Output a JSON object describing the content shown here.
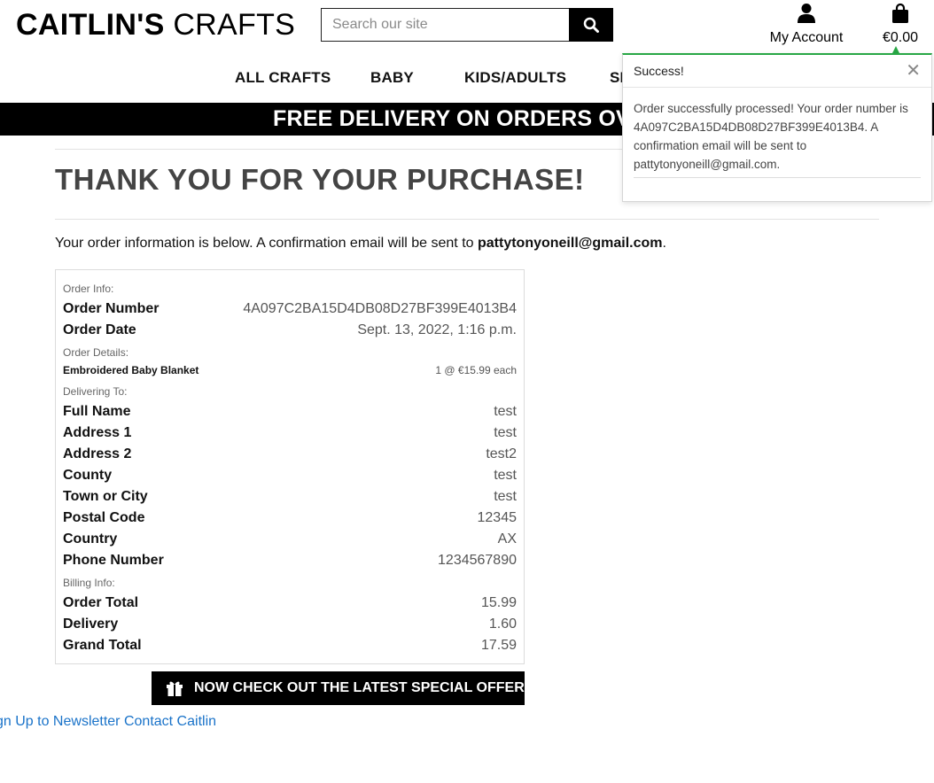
{
  "header": {
    "logo_bold": "CAITLIN'S",
    "logo_thin": "CRAFTS",
    "search_placeholder": "Search our site",
    "account_label": "My Account",
    "bag_total": "€0.00"
  },
  "nav": [
    "ALL CRAFTS",
    "BABY",
    "KIDS/ADULTS",
    "SP"
  ],
  "banner": {
    "text": "FREE DELIVERY ON ORDERS OVER €"
  },
  "toast": {
    "title": "Success!",
    "message": "Order successfully processed! Your order number is 4A097C2BA15D4DB08D27BF399E4013B4. A confirmation email will be sent to pattytonyoneill@gmail.com.",
    "accent_color": "#28a745"
  },
  "main": {
    "title": "THANK YOU FOR YOUR PURCHASE!",
    "intro_text": "Your order information is below. A confirmation email will be sent to ",
    "intro_email": "pattytonyoneill@gmail.com",
    "intro_period": "."
  },
  "order": {
    "info_label": "Order Info:",
    "number_label": "Order Number",
    "number": "4A097C2BA15D4DB08D27BF399E4013B4",
    "date_label": "Order Date",
    "date": "Sept. 13, 2022, 1:16 p.m.",
    "details_label": "Order Details:",
    "item_name": "Embroidered Baby Blanket",
    "item_qty": "1 @ €15.99 each",
    "delivering_label": "Delivering To:",
    "delivery": [
      {
        "label": "Full Name",
        "value": "test"
      },
      {
        "label": "Address 1",
        "value": "test"
      },
      {
        "label": "Address 2",
        "value": "test2"
      },
      {
        "label": "County",
        "value": "test"
      },
      {
        "label": "Town or City",
        "value": "test"
      },
      {
        "label": "Postal Code",
        "value": "12345"
      },
      {
        "label": "Country",
        "value": "AX"
      },
      {
        "label": "Phone Number",
        "value": "1234567890"
      }
    ],
    "billing_label": "Billing Info:",
    "billing": [
      {
        "label": "Order Total",
        "value": "15.99"
      },
      {
        "label": "Delivery",
        "value": "1.60"
      },
      {
        "label": "Grand Total",
        "value": "17.59"
      }
    ]
  },
  "offers_button": "NOW CHECK OUT THE LATEST SPECIAL OFFERS!",
  "footer": {
    "newsletter": "gn Up to Newsletter",
    "contact": "Contact Caitlin"
  }
}
